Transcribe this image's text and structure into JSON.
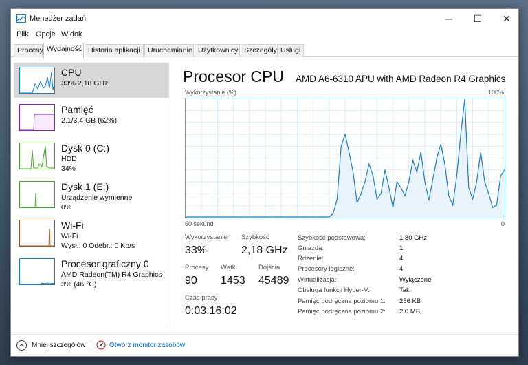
{
  "window": {
    "title": "Menedżer zadań",
    "controls": {
      "minimize": "─",
      "maximize": "☐",
      "close": "✕"
    }
  },
  "menu": {
    "items": [
      "Plik",
      "Opcje",
      "Widok"
    ]
  },
  "tabs": [
    "Procesy",
    "Wydajność",
    "Historia aplikacji",
    "Uruchamianie",
    "Użytkownicy",
    "Szczegóły",
    "Usługi"
  ],
  "active_tab": "Wydajność",
  "sidebar": {
    "items": [
      {
        "title": "CPU",
        "lines": [
          "33% 2,18 GHz"
        ],
        "color": "#1b7fc4",
        "selected": true
      },
      {
        "title": "Pamięć",
        "lines": [
          "2,1/3,4 GB (62%)"
        ],
        "color": "#8b23b8",
        "selected": false
      },
      {
        "title": "Dysk 0 (C:)",
        "lines": [
          "HDD",
          "34%"
        ],
        "color": "#4da32e",
        "selected": false
      },
      {
        "title": "Dysk 1 (E:)",
        "lines": [
          "Urządzenie wymienne",
          "0%"
        ],
        "color": "#4da32e",
        "selected": false
      },
      {
        "title": "Wi-Fi",
        "lines": [
          "Wi-Fi",
          "Wysł.: 0 Odebr.: 0 Kb/s"
        ],
        "color": "#a6521e",
        "selected": false
      },
      {
        "title": "Procesor graficzny 0",
        "lines": [
          "AMD Radeon(TM) R4 Graphics",
          "3% (46 °C)"
        ],
        "color": "#1b7fc4",
        "selected": false
      }
    ]
  },
  "main": {
    "title": "Procesor CPU",
    "model": "AMD A6-6310 APU with AMD Radeon R4 Graphics",
    "graph": {
      "label": "Wykorzystanie (%)",
      "max_label": "100%",
      "time_label": "60 sekund",
      "min_label": "0",
      "values_percent": [
        0,
        0,
        0,
        0,
        0,
        0,
        0,
        0,
        0,
        0,
        0,
        0,
        0,
        0,
        0,
        0,
        0,
        0,
        0,
        0,
        0,
        0,
        0,
        0,
        0,
        0,
        0,
        0,
        0,
        0,
        0,
        0,
        0,
        0,
        0,
        0,
        0,
        3,
        15,
        60,
        70,
        55,
        38,
        12,
        20,
        30,
        45,
        35,
        15,
        20,
        40,
        25,
        8,
        30,
        25,
        18,
        30,
        48,
        38,
        55,
        30,
        14,
        32,
        50,
        62,
        45,
        18,
        10,
        35,
        70,
        100,
        25,
        15,
        30,
        55,
        30,
        20,
        8,
        10,
        35,
        40
      ]
    },
    "stats": {
      "usage": {
        "label": "Wykorzystanie",
        "value": "33%"
      },
      "speed": {
        "label": "Szybkość",
        "value": "2,18 GHz"
      },
      "processes": {
        "label": "Procesy",
        "value": "90"
      },
      "threads": {
        "label": "Wątki",
        "value": "1453"
      },
      "handles": {
        "label": "Dojścia",
        "value": "45489"
      },
      "uptime": {
        "label": "Czas pracy",
        "value": "0:03:16:02"
      }
    },
    "specs": [
      {
        "label": "Szybkość podstawowa:",
        "value": "1,80 GHz"
      },
      {
        "label": "Gniazda:",
        "value": "1"
      },
      {
        "label": "Rdzenie:",
        "value": "4"
      },
      {
        "label": "Procesory logiczne:",
        "value": "4"
      },
      {
        "label": "Wirtualizacja:",
        "value": "Wyłączone"
      },
      {
        "label": "Obsługa funkcji Hyper-V:",
        "value": "Tak"
      },
      {
        "label": "Pamięć podręczna poziomu 1:",
        "value": "256 KB"
      },
      {
        "label": "Pamięć podręczna poziomu 2:",
        "value": "2,0 MB"
      }
    ]
  },
  "footer": {
    "fewer_details": "Mniej szczegółów",
    "resource_monitor": "Otwórz monitor zasobów"
  },
  "colors": {
    "graph_line": "#1b7fc4",
    "graph_fill": "#e8f3fb",
    "grid": "#d7ebf7",
    "link": "#0066cc"
  }
}
